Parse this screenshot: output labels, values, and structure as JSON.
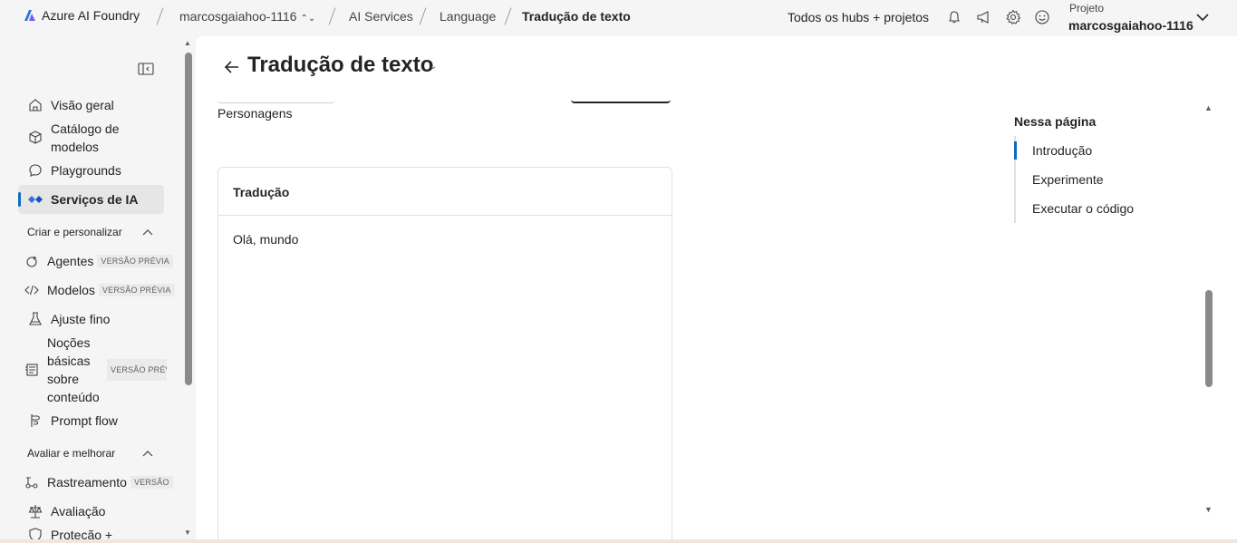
{
  "header": {
    "brand": "Azure AI Foundry",
    "breadcrumbs": [
      "marcosgaiahoo-1116",
      "AI Services",
      "Language",
      "Tradução de texto"
    ],
    "hubs_link": "Todos os hubs + projetos",
    "project_label": "Projeto",
    "project_name": "marcosgaiahoo-1116",
    "icons": [
      "bell-icon",
      "megaphone-icon",
      "gear-icon",
      "smiley-icon",
      "chevron-down-icon"
    ]
  },
  "sidebar": {
    "items": [
      {
        "label": "Visão geral",
        "icon": "home-icon"
      },
      {
        "label": "Catálogo de modelos",
        "icon": "cube-icon"
      },
      {
        "label": "Playgrounds",
        "icon": "chat-icon"
      },
      {
        "label": "Serviços de IA",
        "icon": "ai-services-icon"
      }
    ],
    "section_create": "Criar e personalizar",
    "create_items": [
      {
        "label": "Agentes",
        "badge": "VERSÃO PRÉVIA",
        "icon": "agent-icon"
      },
      {
        "label": "Modelos",
        "badge": "VERSÃO PRÉVIA",
        "icon": "code-icon"
      },
      {
        "label": "Ajuste fino",
        "icon": "flask-icon"
      },
      {
        "label": "Noções básicas sobre conteúdo",
        "badge": "VERSÃO PRÉVIA",
        "icon": "document-icon"
      },
      {
        "label": "Prompt flow",
        "icon": "flow-icon"
      }
    ],
    "section_evaluate": "Avaliar e melhorar",
    "evaluate_items": [
      {
        "label": "Rastreamento",
        "badge": "VERSÃO",
        "icon": "trace-icon"
      },
      {
        "label": "Avaliação",
        "icon": "scale-icon"
      },
      {
        "label": "Proteção +",
        "icon": "shield-icon"
      }
    ]
  },
  "main": {
    "title": "Tradução de texto",
    "personagens": "Personagens",
    "card_title": "Tradução",
    "card_text": "Olá, mundo",
    "toc_title": "Nessa página",
    "toc": [
      "Introdução",
      "Experimente",
      "Executar o código"
    ]
  }
}
